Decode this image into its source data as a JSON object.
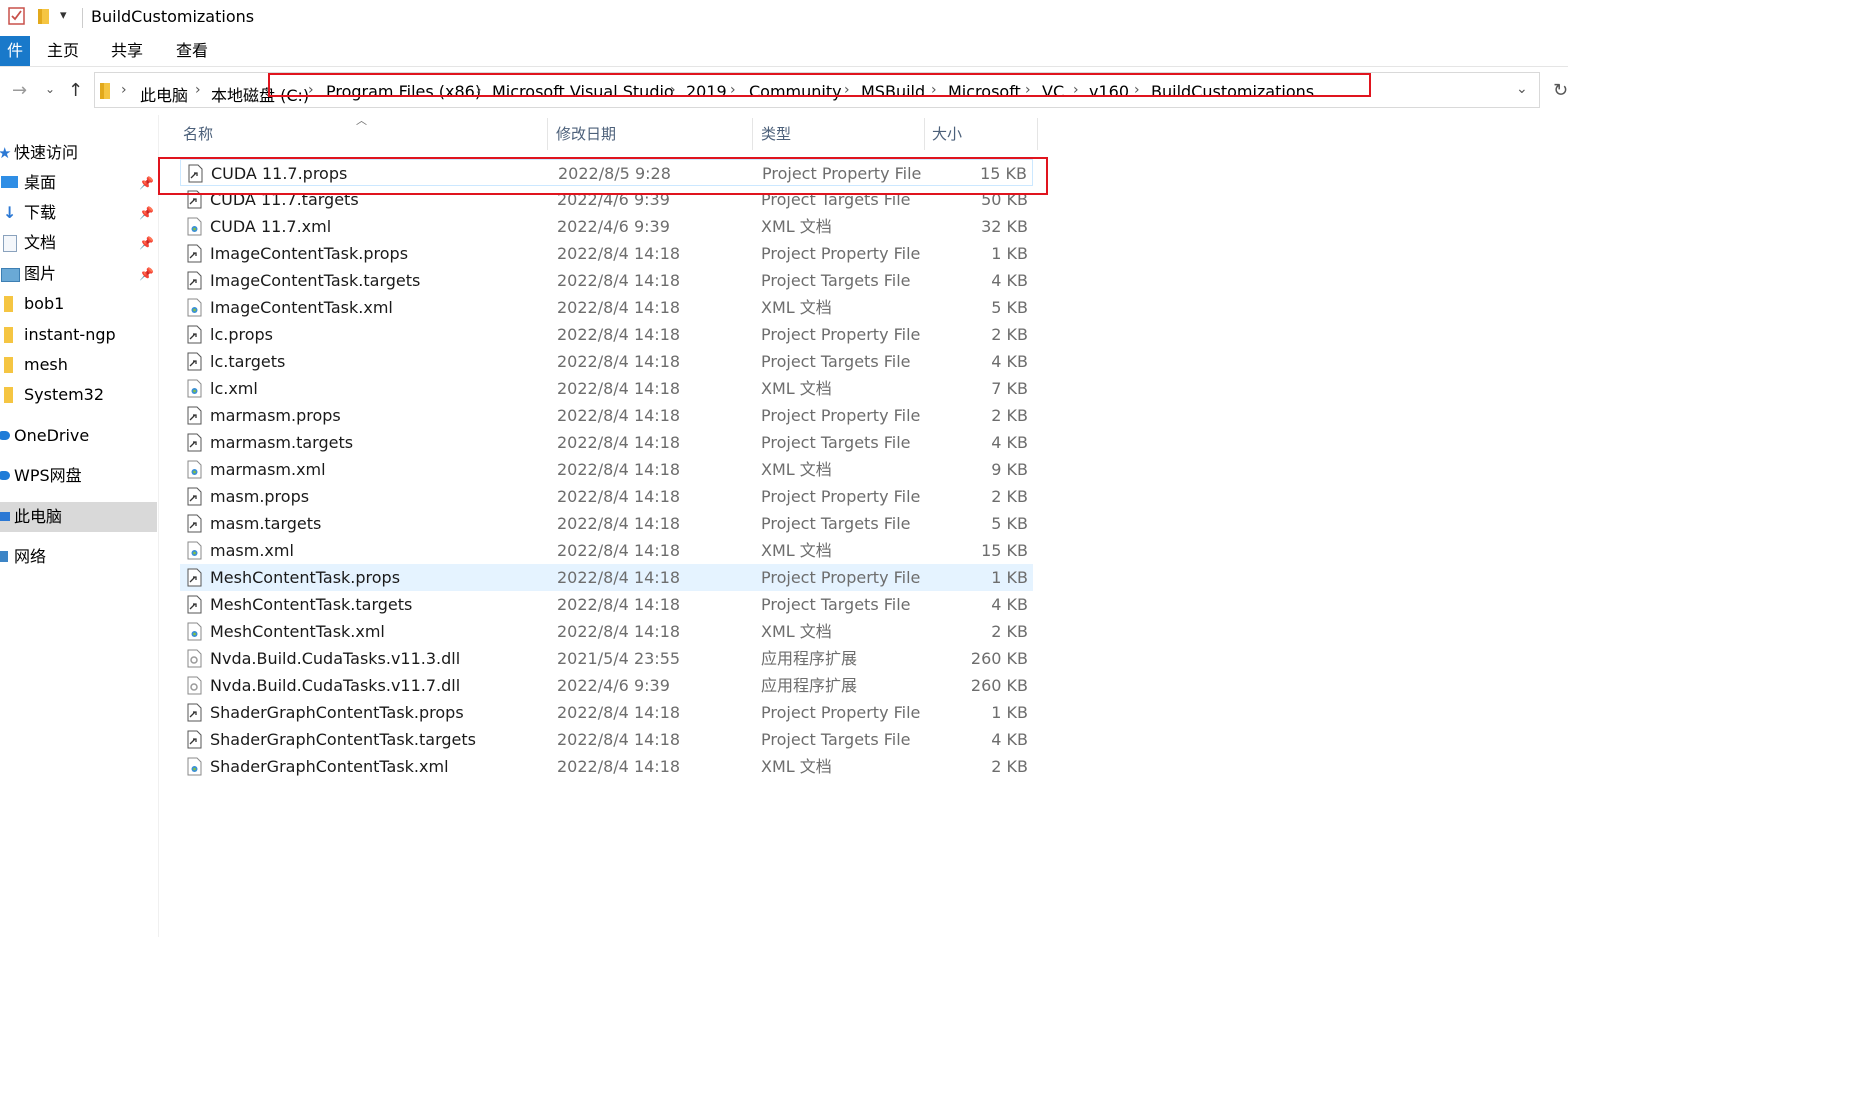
{
  "window": {
    "title": "BuildCustomizations"
  },
  "ribbon": {
    "file_tab": "件",
    "tabs": [
      "主页",
      "共享",
      "查看"
    ]
  },
  "address": {
    "crumbs": [
      "此电脑",
      "本地磁盘 (C:)",
      "Program Files (x86)",
      "Microsoft Visual Studio",
      "2019",
      "Community",
      "MSBuild",
      "Microsoft",
      "VC",
      "v160",
      "BuildCustomizations"
    ]
  },
  "sidebar": {
    "items": [
      {
        "label": "快速访问",
        "icon": "star-icon"
      },
      {
        "label": "桌面",
        "icon": "desktop-icon",
        "pinned": true
      },
      {
        "label": "下载",
        "icon": "download-icon",
        "pinned": true
      },
      {
        "label": "文档",
        "icon": "document-icon",
        "pinned": true
      },
      {
        "label": "图片",
        "icon": "pictures-icon",
        "pinned": true
      },
      {
        "label": "bob1",
        "icon": "folder-icon"
      },
      {
        "label": "instant-ngp",
        "icon": "folder-icon"
      },
      {
        "label": "mesh",
        "icon": "folder-icon"
      },
      {
        "label": "System32",
        "icon": "folder-icon"
      },
      {
        "label": "OneDrive",
        "icon": "cloud-icon"
      },
      {
        "label": "WPS网盘",
        "icon": "cloud-icon"
      },
      {
        "label": "此电脑",
        "icon": "computer-icon",
        "selected": true
      },
      {
        "label": "网络",
        "icon": "network-icon"
      }
    ]
  },
  "columns": {
    "name": "名称",
    "date": "修改日期",
    "type": "类型",
    "size": "大小"
  },
  "files": [
    {
      "name": "CUDA 11.7.props",
      "date": "2022/8/5 9:28",
      "type": "Project Property File",
      "size": "15 KB",
      "icon": "props-file-icon"
    },
    {
      "name": "CUDA 11.7.targets",
      "date": "2022/4/6 9:39",
      "type": "Project Targets File",
      "size": "50 KB",
      "icon": "props-file-icon"
    },
    {
      "name": "CUDA 11.7.xml",
      "date": "2022/4/6 9:39",
      "type": "XML 文档",
      "size": "32 KB",
      "icon": "xml-file-icon"
    },
    {
      "name": "ImageContentTask.props",
      "date": "2022/8/4 14:18",
      "type": "Project Property File",
      "size": "1 KB",
      "icon": "props-file-icon"
    },
    {
      "name": "ImageContentTask.targets",
      "date": "2022/8/4 14:18",
      "type": "Project Targets File",
      "size": "4 KB",
      "icon": "props-file-icon"
    },
    {
      "name": "ImageContentTask.xml",
      "date": "2022/8/4 14:18",
      "type": "XML 文档",
      "size": "5 KB",
      "icon": "xml-file-icon"
    },
    {
      "name": "lc.props",
      "date": "2022/8/4 14:18",
      "type": "Project Property File",
      "size": "2 KB",
      "icon": "props-file-icon"
    },
    {
      "name": "lc.targets",
      "date": "2022/8/4 14:18",
      "type": "Project Targets File",
      "size": "4 KB",
      "icon": "props-file-icon"
    },
    {
      "name": "lc.xml",
      "date": "2022/8/4 14:18",
      "type": "XML 文档",
      "size": "7 KB",
      "icon": "xml-file-icon"
    },
    {
      "name": "marmasm.props",
      "date": "2022/8/4 14:18",
      "type": "Project Property File",
      "size": "2 KB",
      "icon": "props-file-icon"
    },
    {
      "name": "marmasm.targets",
      "date": "2022/8/4 14:18",
      "type": "Project Targets File",
      "size": "4 KB",
      "icon": "props-file-icon"
    },
    {
      "name": "marmasm.xml",
      "date": "2022/8/4 14:18",
      "type": "XML 文档",
      "size": "9 KB",
      "icon": "xml-file-icon"
    },
    {
      "name": "masm.props",
      "date": "2022/8/4 14:18",
      "type": "Project Property File",
      "size": "2 KB",
      "icon": "props-file-icon"
    },
    {
      "name": "masm.targets",
      "date": "2022/8/4 14:18",
      "type": "Project Targets File",
      "size": "5 KB",
      "icon": "props-file-icon"
    },
    {
      "name": "masm.xml",
      "date": "2022/8/4 14:18",
      "type": "XML 文档",
      "size": "15 KB",
      "icon": "xml-file-icon"
    },
    {
      "name": "MeshContentTask.props",
      "date": "2022/8/4 14:18",
      "type": "Project Property File",
      "size": "1 KB",
      "icon": "props-file-icon",
      "hovered": true
    },
    {
      "name": "MeshContentTask.targets",
      "date": "2022/8/4 14:18",
      "type": "Project Targets File",
      "size": "4 KB",
      "icon": "props-file-icon"
    },
    {
      "name": "MeshContentTask.xml",
      "date": "2022/8/4 14:18",
      "type": "XML 文档",
      "size": "2 KB",
      "icon": "xml-file-icon"
    },
    {
      "name": "Nvda.Build.CudaTasks.v11.3.dll",
      "date": "2021/5/4 23:55",
      "type": "应用程序扩展",
      "size": "260 KB",
      "icon": "dll-file-icon"
    },
    {
      "name": "Nvda.Build.CudaTasks.v11.7.dll",
      "date": "2022/4/6 9:39",
      "type": "应用程序扩展",
      "size": "260 KB",
      "icon": "dll-file-icon"
    },
    {
      "name": "ShaderGraphContentTask.props",
      "date": "2022/8/4 14:18",
      "type": "Project Property File",
      "size": "1 KB",
      "icon": "props-file-icon"
    },
    {
      "name": "ShaderGraphContentTask.targets",
      "date": "2022/8/4 14:18",
      "type": "Project Targets File",
      "size": "4 KB",
      "icon": "props-file-icon"
    },
    {
      "name": "ShaderGraphContentTask.xml",
      "date": "2022/8/4 14:18",
      "type": "XML 文档",
      "size": "2 KB",
      "icon": "xml-file-icon"
    }
  ],
  "colors": {
    "accent": "#1979ca",
    "annotation": "#e0141e",
    "hover_row": "#e5f3ff",
    "selected_sidebar": "#d9d9d9"
  }
}
